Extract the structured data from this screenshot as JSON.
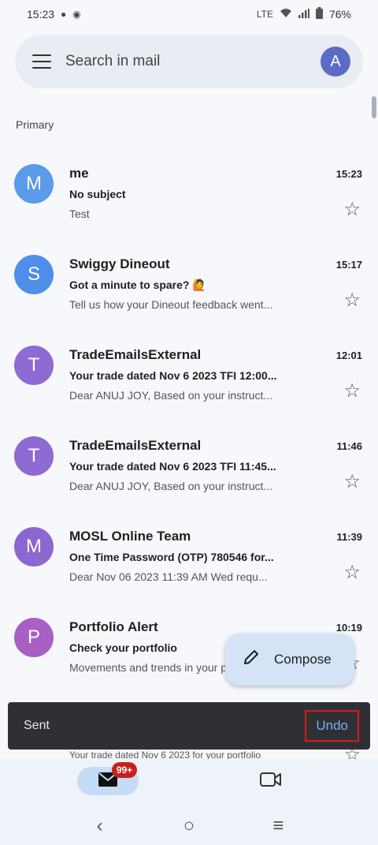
{
  "status": {
    "time": "15:23",
    "battery": "76%",
    "network": "LTE"
  },
  "search": {
    "placeholder": "Search in mail",
    "account_initial": "A"
  },
  "section": "Primary",
  "emails": [
    {
      "initial": "M",
      "color": "#5b9bea",
      "sender": "me",
      "time": "15:23",
      "subject": "No subject",
      "snippet": "Test"
    },
    {
      "initial": "S",
      "color": "#4f8ee9",
      "sender": "Swiggy Dineout",
      "time": "15:17",
      "subject": "Got a minute to spare? 🙋",
      "snippet": "Tell us how your Dineout feedback went..."
    },
    {
      "initial": "T",
      "color": "#8d6bd2",
      "sender": "TradeEmailsExternal",
      "time": "12:01",
      "subject": "Your trade dated Nov 6 2023 TFI 12:00...",
      "snippet": "Dear ANUJ JOY, Based on your instruct..."
    },
    {
      "initial": "T",
      "color": "#8d6bd2",
      "sender": "TradeEmailsExternal",
      "time": "11:46",
      "subject": "Your trade dated Nov 6 2023 TFI 11:45...",
      "snippet": "Dear ANUJ JOY, Based on your instruct..."
    },
    {
      "initial": "M",
      "color": "#8a68cf",
      "sender": "MOSL Online Team",
      "time": "11:39",
      "subject": "One Time Password (OTP) 780546 for...",
      "snippet": "Dear Nov 06 2023 11:39 AM Wed requ..."
    },
    {
      "initial": "P",
      "color": "#a860c4",
      "sender": "Portfolio Alert",
      "time": "10:19",
      "subject": "Check your portfolio",
      "snippet": "Movements and trends in your portfolio..."
    }
  ],
  "under_snippet": "Your trade dated Nov 6 2023 for your portfolio",
  "compose": {
    "label": "Compose"
  },
  "snackbar": {
    "text": "Sent",
    "action": "Undo"
  },
  "nav": {
    "badge": "99+"
  },
  "colors": {
    "accent": "#1a73e8",
    "snackbar_bg": "#2f3033",
    "undo": "#7cacf8",
    "badge": "#c5221f"
  }
}
